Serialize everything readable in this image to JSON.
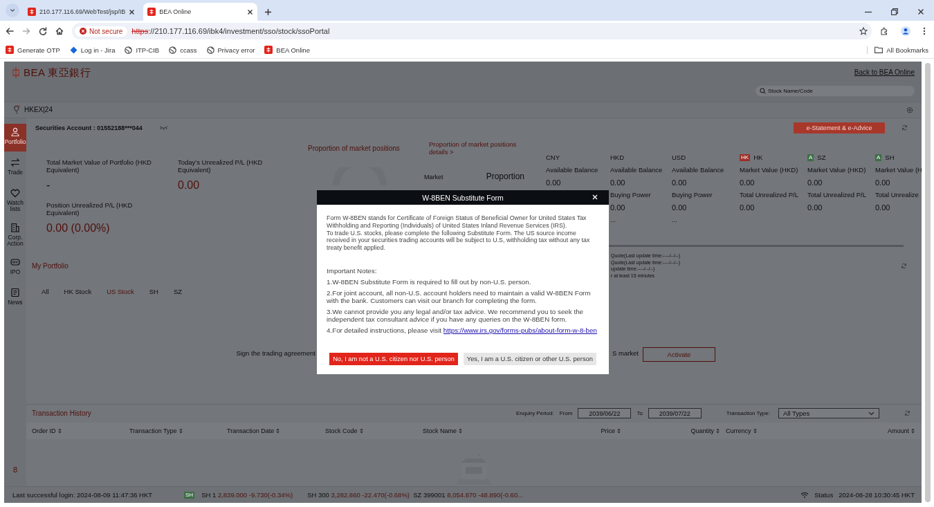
{
  "browser": {
    "tabs": [
      {
        "title": "210.177.116.69/WebTest/jsp/IB",
        "selected": false
      },
      {
        "title": "BEA Online",
        "selected": true
      }
    ],
    "security_label": "Not secure",
    "url": {
      "scheme": "https",
      "rest": "://210.177.116.69/ibk4/investment/sso/stock/ssoPortal"
    },
    "bookmarks": [
      {
        "label": "Generate OTP",
        "kind": "bea"
      },
      {
        "label": "Log in - Jira",
        "kind": "jira"
      },
      {
        "label": "ITP-CIB",
        "kind": "globe"
      },
      {
        "label": "ccass",
        "kind": "globe"
      },
      {
        "label": "Privacy error",
        "kind": "globe"
      },
      {
        "label": "BEA Online",
        "kind": "bea"
      }
    ],
    "all_bookmarks": "All Bookmarks"
  },
  "header": {
    "logo_text": "BEA",
    "logo_chinese": "東亞銀行",
    "back_link": "Back to BEA Online",
    "search": {
      "placeholder": "Stock Name/Code"
    }
  },
  "exchange_bar": {
    "label": "HKEX|24"
  },
  "sidebar": {
    "items": [
      {
        "label": "Portfolio",
        "kind": "person",
        "selected": true
      },
      {
        "label": "Trade",
        "kind": "swap",
        "selected": false
      },
      {
        "label": "Watch lists",
        "kind": "heart",
        "selected": false
      },
      {
        "label": "Corp. Action",
        "kind": "building",
        "selected": false
      },
      {
        "label": "IPO",
        "kind": "tag",
        "selected": false
      },
      {
        "label": "News",
        "kind": "news",
        "selected": false
      }
    ],
    "badge": "8"
  },
  "account": {
    "label": "Securities Account : 01552188***044",
    "statement_button": "e-Statement & e-Advice"
  },
  "summary": {
    "metrics": [
      {
        "label": "Total Market Value of Portfolio (HKD Equivalent)",
        "value": "-",
        "color": "#0c0d0f"
      },
      {
        "label": "Today's Unrealized P/L (HKD Equivalent)",
        "value": "0.00",
        "color": "#4f100b"
      },
      {
        "label": "Position Unrealized P/L (HKD Equivalent)",
        "value": "0.00 (0.00%)",
        "color": "#4f100b"
      }
    ]
  },
  "proportion": {
    "title": "Proportion of market positions",
    "details_link": "Proportion of market positions details >",
    "market_header": "Market",
    "proportion_header": "Proportion"
  },
  "balances": [
    {
      "currency": "CNY",
      "available_label": "Available Balance",
      "available": "0.00"
    },
    {
      "currency": "HKD",
      "available_label": "Available Balance",
      "available": "0.00",
      "buying_label": "Buying Power",
      "buying": "0.00",
      "more": "..."
    },
    {
      "currency": "USD",
      "available_label": "Available Balance",
      "available": "0.00",
      "buying_label": "Buying Power",
      "buying": "0.00",
      "more": "..."
    }
  ],
  "markets": [
    {
      "market": "HK",
      "flag": "HK",
      "color": "#9b2f2a",
      "value_label": "Market Value (HKD)",
      "value": "0.00",
      "pl_label": "Total Unrealized P/L",
      "pl": "0.00"
    },
    {
      "market": "SZ",
      "flag": "A",
      "color": "#3c6e46",
      "value_label": "Market Value (HKD)",
      "value": "0.00",
      "pl_label": "Total Unrealized P/L",
      "pl": "0.00"
    },
    {
      "market": "SH",
      "flag": "A",
      "color": "#3c6e46",
      "value_label": "Market Value (H",
      "value": "0.00",
      "pl_label": "Total Unrealize",
      "pl": "0.00"
    }
  ],
  "quote_notes": [
    "Quote(Last update time:----/--/--)",
    "Quote(Last update time:----/--/--)",
    "update time:----/--/--)",
    "r at least 15 minutes"
  ],
  "portfolio": {
    "title": "My Portfolio",
    "tabs": [
      {
        "label": "All",
        "selected": false
      },
      {
        "label": "HK Stock",
        "selected": false
      },
      {
        "label": "US Stock",
        "selected": true
      },
      {
        "label": "SH",
        "selected": false
      },
      {
        "label": "SZ",
        "selected": false
      }
    ],
    "agreement_text": "Sign the trading agreement",
    "agreement_tail": "S market",
    "activate_button": "Activate"
  },
  "transactions": {
    "title": "Transaction History",
    "period_label": "Enquiry Period:",
    "from_label": "From",
    "from": "2039/06/22",
    "to_label": "To",
    "to": "2039/07/22",
    "type_label": "Transaction Type:",
    "type": "All Types",
    "columns": [
      "Order ID",
      "Transaction Type",
      "Transaction Date",
      "Stock Code",
      "Stock Name",
      "Price",
      "Quantity",
      "Currency",
      "Amount"
    ]
  },
  "status_bar": {
    "last_login": "Last successful login: 2024-08-09 11:47:36 HKT",
    "index_badge": "SH",
    "tickers": [
      {
        "name": "SH 1",
        "quote": "2,839.000 -9.730(-0.34%)"
      },
      {
        "name": "SH 300",
        "quote": "3,282.860 -22.470(-0.68%)"
      },
      {
        "name": "SZ 399001",
        "quote": "8,054.870 -48.890(-0.60..."
      }
    ],
    "status_label": "Status",
    "status_time": "2024-08-28 10:30:45 HKT"
  },
  "modal": {
    "title": "W-8BEN Substitute Form",
    "intro": [
      "Form W-8BEN stands for Certificate of Foreign Status of Beneficial Owner for United States Tax Withholding and Reporting (Individuals) of United States Inland Revenue Services (IRS).",
      "To trade U.S. stocks, please complete the following Substitute Form. The US source income received in your securities trading accounts will be subject to U.S, withholding tax without any tax treaty benefit applied."
    ],
    "notes_title": "Important Notes:",
    "notes": [
      "1.W-8BEN Substitute Form is required to fill out by non-U.S. person.",
      "2.For joint account, all non-U.S. account holders need to maintain a valid W-8BEN Form with the bank. Customers can visit our branch for completing the form.",
      "3.We cannot provide you any legal and/or tax advice. We recommend you to seek the independent tax consultant advice if you have any queries on the W-8BEN form."
    ],
    "link_note": {
      "text": "4.For detailed instructions, please visit",
      "link": "https://www.irs.gov/forms-pubs/about-form-w-8-ben"
    },
    "buttons": [
      {
        "label": "No, I am not a U.S. citizen nor U.S. person",
        "kind": "primary"
      },
      {
        "label": "Yes, I am a U.S. citizen or other U.S. person",
        "kind": "secondary"
      }
    ]
  }
}
